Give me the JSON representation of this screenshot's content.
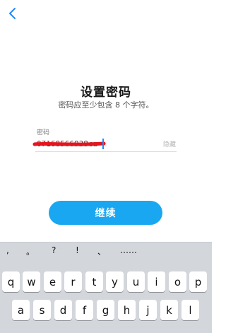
{
  "icons": {
    "back": "chevron-left-icon"
  },
  "colors": {
    "accent": "#1aa7f2",
    "caret": "#1a8cff",
    "redaction": "#e6141c",
    "keyboard_bg": "#d3d7dc"
  },
  "page": {
    "title": "设置密码",
    "subtitle": "密码应至少包含 8 个字符。"
  },
  "password_field": {
    "label": "密码",
    "value": "07168566938ca",
    "toggle_label": "隐藏"
  },
  "continue_button": {
    "label": "继续"
  },
  "keyboard": {
    "punctuation": [
      ",",
      "。",
      "?",
      "!",
      "、",
      "……"
    ],
    "row1": [
      "q",
      "w",
      "e",
      "r",
      "t",
      "y",
      "u",
      "i",
      "o",
      "p"
    ],
    "row2": [
      "a",
      "s",
      "d",
      "f",
      "g",
      "h",
      "j",
      "k",
      "l"
    ]
  }
}
